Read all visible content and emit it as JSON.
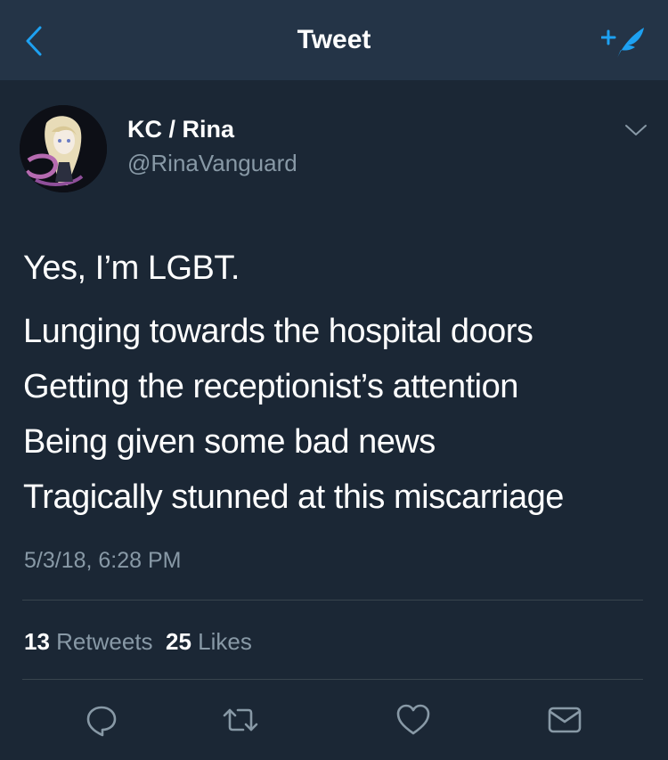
{
  "navbar": {
    "title": "Tweet",
    "back_icon": "chevron-left-icon",
    "compose_icon": "compose-tweet-icon",
    "accent_color": "#1da1f2"
  },
  "tweet": {
    "author": {
      "display_name": "KC / Rina",
      "handle": "@RinaVanguard"
    },
    "lines": [
      "Yes, I’m LGBT.",
      "Lunging towards the hospital doors",
      "Getting the receptionist’s attention",
      "Being given some bad news",
      "Tragically stunned at this miscarriage"
    ],
    "timestamp": "5/3/18, 6:28 PM",
    "stats": {
      "retweets_count": "13",
      "retweets_label": "Retweets",
      "likes_count": "25",
      "likes_label": "Likes"
    },
    "actions": [
      "reply-icon",
      "retweet-icon",
      "like-icon",
      "direct-message-icon"
    ]
  },
  "colors": {
    "background": "#1b2735",
    "header": "#243447",
    "secondary_text": "#8899a6"
  }
}
